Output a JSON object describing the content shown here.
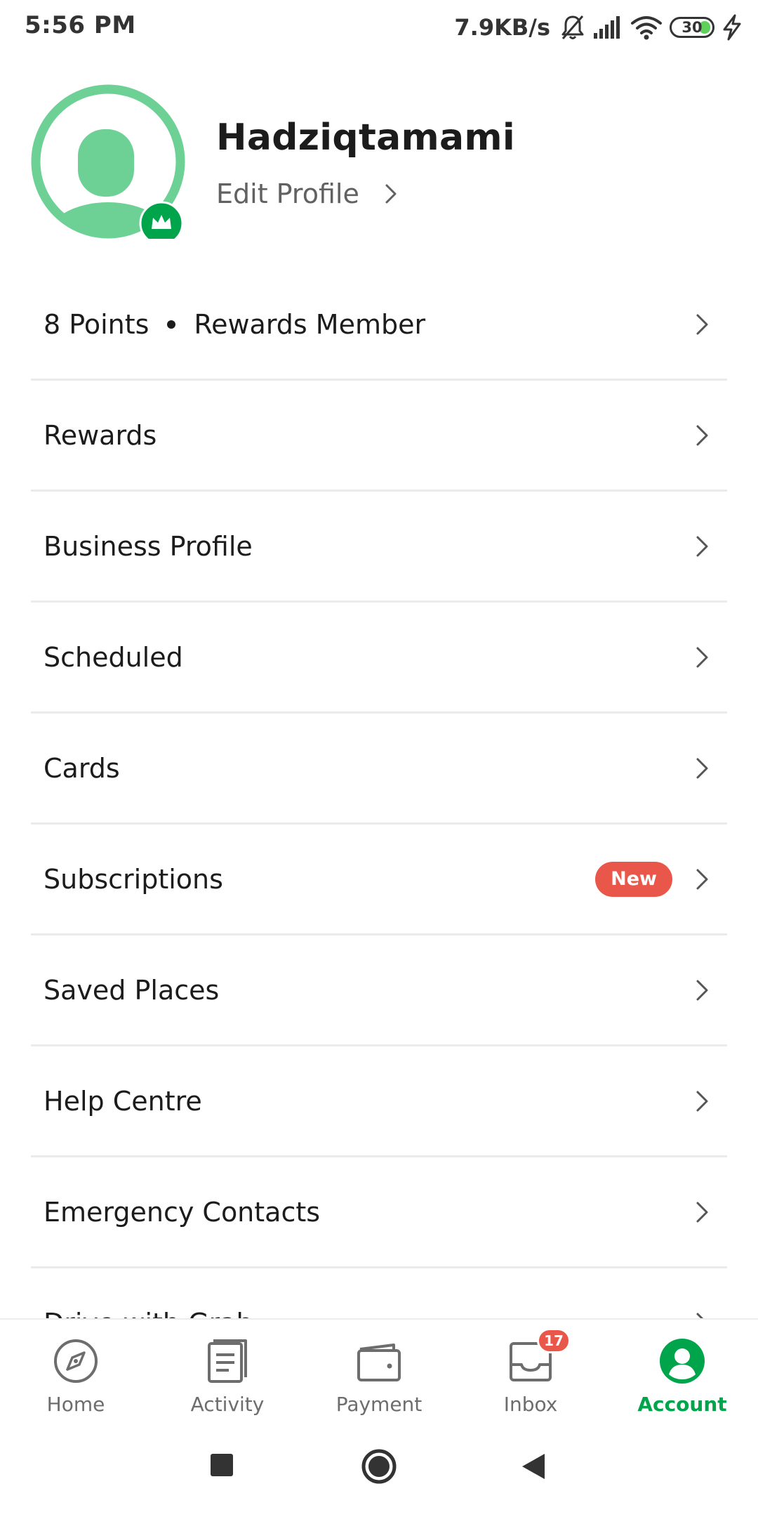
{
  "status_bar": {
    "time": "5:56 PM",
    "network_speed": "7.9KB/s",
    "battery_level": "30",
    "battery_fraction": 0.3
  },
  "profile": {
    "name": "Hadziqtamami",
    "edit_profile_label": "Edit Profile"
  },
  "menu": {
    "items": [
      {
        "id": "points",
        "label": "8 Points",
        "secondary": "Rewards Member"
      },
      {
        "id": "rewards",
        "label": "Rewards"
      },
      {
        "id": "business-profile",
        "label": "Business Profile"
      },
      {
        "id": "scheduled",
        "label": "Scheduled"
      },
      {
        "id": "cards",
        "label": "Cards"
      },
      {
        "id": "subscriptions",
        "label": "Subscriptions",
        "badge": "New"
      },
      {
        "id": "saved-places",
        "label": "Saved Places"
      },
      {
        "id": "help-centre",
        "label": "Help Centre"
      },
      {
        "id": "emergency-contacts",
        "label": "Emergency Contacts"
      },
      {
        "id": "drive-with-grab",
        "label": "Drive with Grab"
      }
    ]
  },
  "bottom_nav": {
    "items": [
      {
        "id": "home",
        "label": "Home",
        "icon": "compass-icon"
      },
      {
        "id": "activity",
        "label": "Activity",
        "icon": "document-icon"
      },
      {
        "id": "payment",
        "label": "Payment",
        "icon": "wallet-icon"
      },
      {
        "id": "inbox",
        "label": "Inbox",
        "icon": "inbox-icon",
        "badge": "17"
      },
      {
        "id": "account",
        "label": "Account",
        "icon": "account-icon",
        "active": true
      }
    ]
  },
  "colors": {
    "brand_green": "#00a44a",
    "avatar_green": "#6dd196",
    "badge_red": "#e8574a",
    "divider": "#ebebeb"
  }
}
